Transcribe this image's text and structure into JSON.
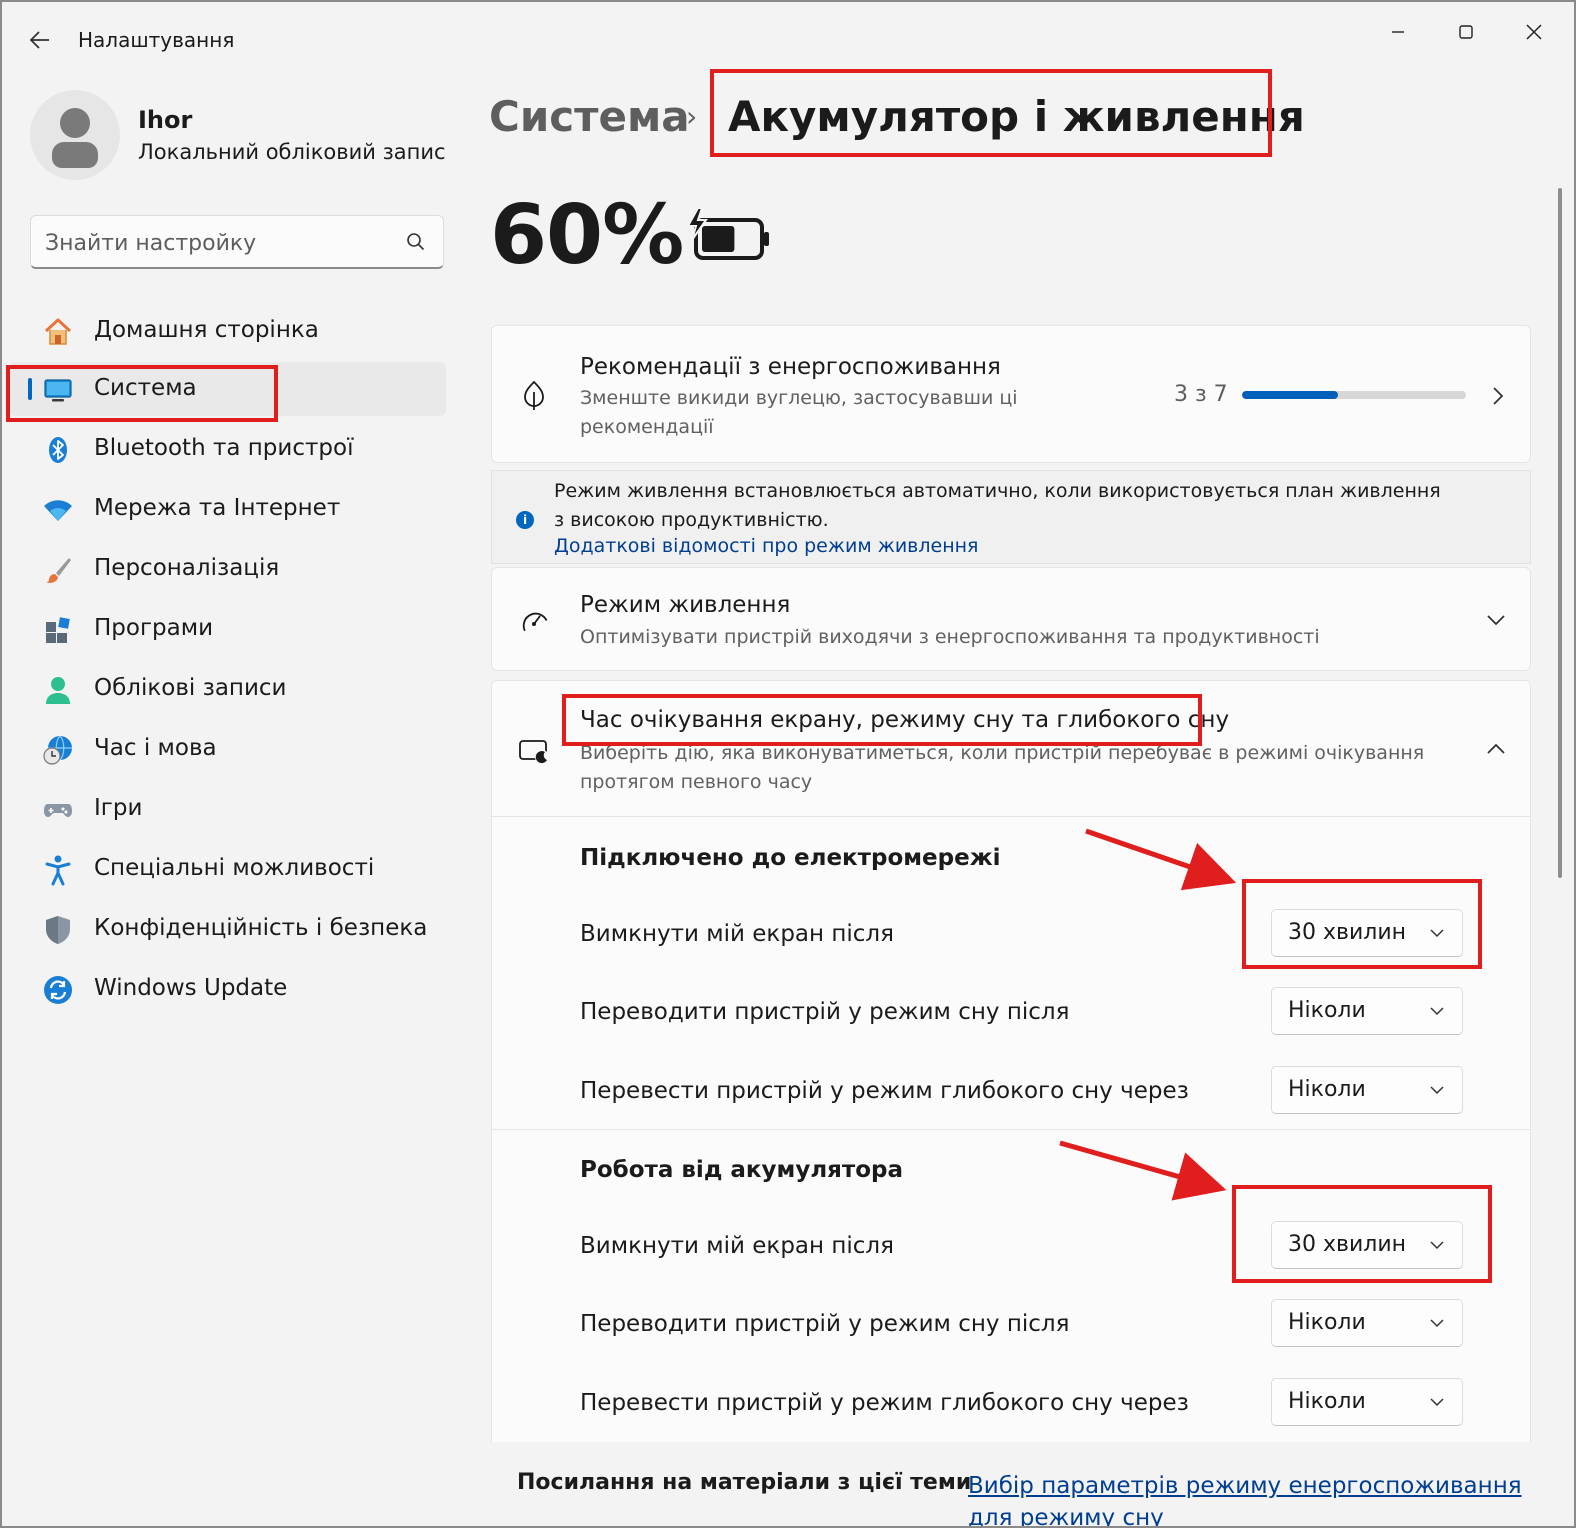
{
  "window": {
    "title": "Налаштування"
  },
  "profile": {
    "name": "Ihor",
    "account_type": "Локальний обліковий запис"
  },
  "search": {
    "placeholder": "Знайти настройку"
  },
  "sidebar": {
    "items": [
      {
        "label": "Домашня сторінка",
        "icon": "home-icon"
      },
      {
        "label": "Система",
        "icon": "system-icon"
      },
      {
        "label": "Bluetooth та пристрої",
        "icon": "bluetooth-icon"
      },
      {
        "label": "Мережа та Інтернет",
        "icon": "wifi-icon"
      },
      {
        "label": "Персоналізація",
        "icon": "brush-icon"
      },
      {
        "label": "Програми",
        "icon": "apps-icon"
      },
      {
        "label": "Облікові записи",
        "icon": "accounts-icon"
      },
      {
        "label": "Час і мова",
        "icon": "time-language-icon"
      },
      {
        "label": "Ігри",
        "icon": "gamepad-icon"
      },
      {
        "label": "Спеціальні можливості",
        "icon": "accessibility-icon"
      },
      {
        "label": "Конфіденційність і безпека",
        "icon": "shield-icon"
      },
      {
        "label": "Windows Update",
        "icon": "update-icon"
      }
    ]
  },
  "header": {
    "breadcrumb_parent": "Система",
    "breadcrumb_separator": "›",
    "breadcrumb_current": "Акумулятор і живлення",
    "battery_percent": "60%",
    "battery_level": 0.6
  },
  "recommendations": {
    "title": "Рекомендації з енергоспоживання",
    "subtitle": "Зменште викиди вуглецю, застосувавши ці рекомендації",
    "progress_text": "3 з 7",
    "progress_value": 3,
    "progress_max": 7
  },
  "info": {
    "text": "Режим живлення встановлюється автоматично, коли використовується план живлення з високою продуктивністю.",
    "link": "Додаткові відомості про режим живлення"
  },
  "power_mode": {
    "title": "Режим живлення",
    "subtitle": "Оптимізувати пристрій виходячи з енергоспоживання та продуктивності"
  },
  "timeouts": {
    "title": "Час очікування екрану, режиму сну та глибокого сну",
    "subtitle": "Виберіть дію, яка виконуватиметься, коли пристрій перебуває в режимі очікування протягом певного часу",
    "plugged_in": {
      "heading": "Підключено до електромережі",
      "rows": [
        {
          "label": "Вимкнути мій екран після",
          "value": "30 хвилин"
        },
        {
          "label": "Переводити пристрій у режим сну після",
          "value": "Ніколи"
        },
        {
          "label": "Перевести пристрій у режим глибокого сну через",
          "value": "Ніколи"
        }
      ]
    },
    "on_battery": {
      "heading": "Робота від акумулятора",
      "rows": [
        {
          "label": "Вимкнути мій екран після",
          "value": "30 хвилин"
        },
        {
          "label": "Переводити пристрій у режим сну після",
          "value": "Ніколи"
        },
        {
          "label": "Перевести пристрій у режим глибокого сну через",
          "value": "Ніколи"
        }
      ]
    }
  },
  "related": {
    "label": "Посилання на матеріали з цієї теми",
    "link": "Вибір параметрів режиму енергоспоживання для режиму сну"
  },
  "colors": {
    "accent": "#0067c0",
    "link": "#003e92",
    "annotation": "#e01e1e"
  }
}
